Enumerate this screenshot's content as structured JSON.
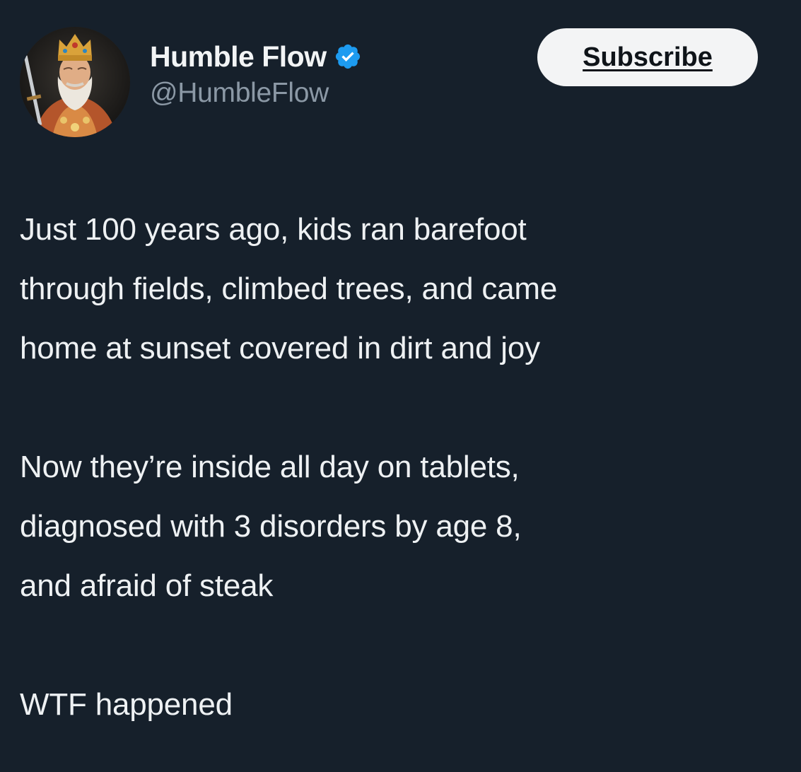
{
  "tweet": {
    "author": {
      "display_name": "Humble Flow",
      "handle": "@HumbleFlow",
      "verified": true,
      "verified_icon": "verified-badge-icon",
      "avatar": "medieval-emperor-portrait"
    },
    "subscribe_label": "Subscribe",
    "body": {
      "paragraph_1": "Just 100 years ago, kids ran barefoot\nthrough fields, climbed trees, and came\nhome at sunset covered in dirt and joy",
      "paragraph_2": "Now they’re inside all day on tablets,\ndiagnosed with 3 disorders by age 8,\nand afraid of steak",
      "paragraph_3": "WTF happened"
    }
  },
  "colors": {
    "background": "#16202b",
    "text_primary": "#eef1f3",
    "text_secondary": "#8b98a5",
    "verified_blue": "#1d9bf0",
    "button_bg": "#f3f4f5",
    "button_text": "#0f1419"
  }
}
